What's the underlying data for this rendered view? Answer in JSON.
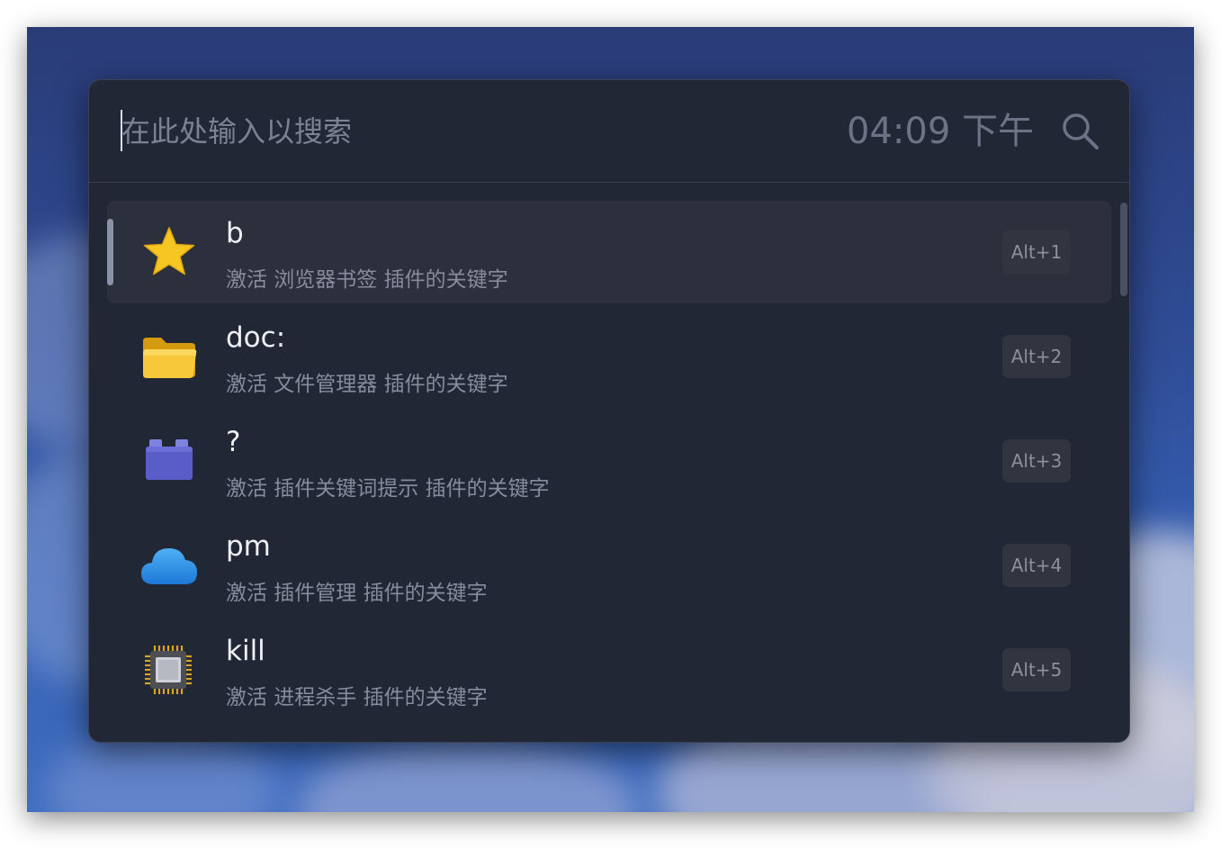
{
  "search": {
    "placeholder": "在此处输入以搜索",
    "value": "",
    "clock": "04:09 下午"
  },
  "results": [
    {
      "title": "b",
      "subtitle": "激活 浏览器书签 插件的关键字",
      "hotkey": "Alt+1",
      "icon": "star-icon",
      "selected": true
    },
    {
      "title": "doc:",
      "subtitle": "激活 文件管理器 插件的关键字",
      "hotkey": "Alt+2",
      "icon": "folder-icon",
      "selected": false
    },
    {
      "title": "?",
      "subtitle": "激活 插件关键词提示 插件的关键字",
      "hotkey": "Alt+3",
      "icon": "lego-block-icon",
      "selected": false
    },
    {
      "title": "pm",
      "subtitle": "激活 插件管理 插件的关键字",
      "hotkey": "Alt+4",
      "icon": "cloud-icon",
      "selected": false
    },
    {
      "title": "kill",
      "subtitle": "激活 进程杀手 插件的关键字",
      "hotkey": "Alt+5",
      "icon": "cpu-chip-icon",
      "selected": false
    }
  ],
  "colors": {
    "panel": "#222735",
    "selected_row": "#2c303d",
    "title_text": "#eef0f5",
    "subtitle_text": "#868c9c",
    "star": "#f6c623",
    "folder": "#f1b825",
    "lego": "#5a5dc8",
    "cloud": "#2d8fe6"
  }
}
